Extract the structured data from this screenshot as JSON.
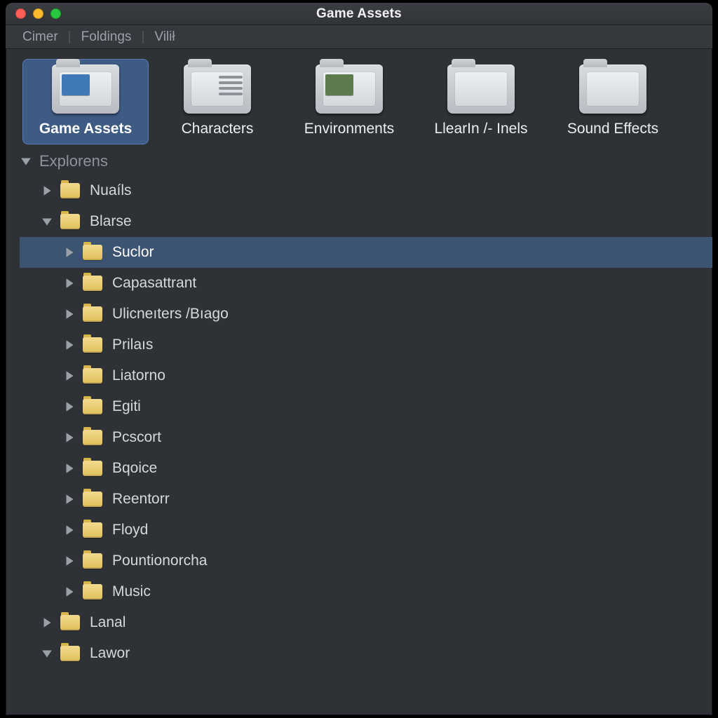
{
  "window": {
    "title": "Game Assets"
  },
  "menubar": {
    "items": [
      "Cimer",
      "Foldings",
      "Vilił"
    ]
  },
  "iconrow": {
    "items": [
      {
        "label": "Game Assets",
        "selected": true,
        "icon": "folder-thumb"
      },
      {
        "label": "Characters",
        "selected": false,
        "icon": "folder-lines"
      },
      {
        "label": "Environments",
        "selected": false,
        "icon": "folder-thumb"
      },
      {
        "label": "LlearIn /- Inels",
        "selected": false,
        "icon": "folder-plain"
      },
      {
        "label": "Sound Effects",
        "selected": false,
        "icon": "folder-plain"
      }
    ]
  },
  "tree": {
    "header": {
      "label": "Explorens",
      "expanded": true
    },
    "nodes": [
      {
        "label": "Nuaíls",
        "depth": 1,
        "expanded": false,
        "selected": false
      },
      {
        "label": "Blarse",
        "depth": 1,
        "expanded": true,
        "selected": false
      },
      {
        "label": "Suclor",
        "depth": 2,
        "expanded": false,
        "selected": true
      },
      {
        "label": "Capasattrant",
        "depth": 2,
        "expanded": false,
        "selected": false
      },
      {
        "label": "Ulicneıters /Bıago",
        "depth": 2,
        "expanded": false,
        "selected": false
      },
      {
        "label": "Prilaıs",
        "depth": 2,
        "expanded": false,
        "selected": false
      },
      {
        "label": "Liatorno",
        "depth": 2,
        "expanded": false,
        "selected": false
      },
      {
        "label": "Egiti",
        "depth": 2,
        "expanded": false,
        "selected": false
      },
      {
        "label": "Pcscort",
        "depth": 2,
        "expanded": false,
        "selected": false
      },
      {
        "label": "Bqoice",
        "depth": 2,
        "expanded": false,
        "selected": false
      },
      {
        "label": "Reentorr",
        "depth": 2,
        "expanded": false,
        "selected": false
      },
      {
        "label": "Floyd",
        "depth": 2,
        "expanded": false,
        "selected": false
      },
      {
        "label": "Pountionorcha",
        "depth": 2,
        "expanded": false,
        "selected": false
      },
      {
        "label": "Music",
        "depth": 2,
        "expanded": false,
        "selected": false
      },
      {
        "label": "Lanal",
        "depth": 1,
        "expanded": false,
        "selected": false
      },
      {
        "label": "Lawor",
        "depth": 1,
        "expanded": true,
        "selected": false
      }
    ]
  }
}
